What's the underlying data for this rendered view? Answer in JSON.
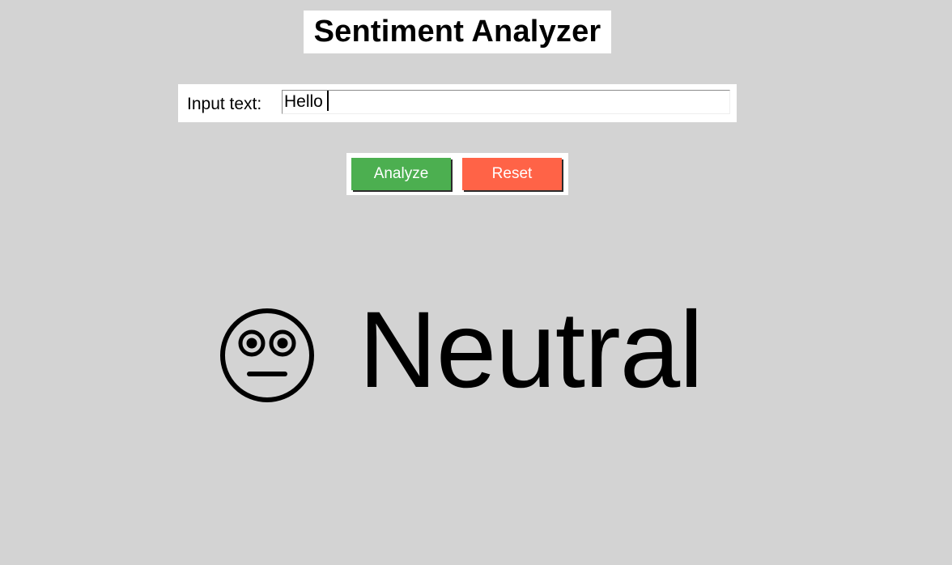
{
  "app": {
    "title": "Sentiment Analyzer"
  },
  "input": {
    "label": "Input text:",
    "value": "Hello"
  },
  "buttons": {
    "analyze_label": "Analyze",
    "analyze_color": "#4caf50",
    "reset_label": "Reset",
    "reset_color": "#ff6347"
  },
  "result": {
    "icon": "neutral-face-icon",
    "label": "Neutral"
  }
}
